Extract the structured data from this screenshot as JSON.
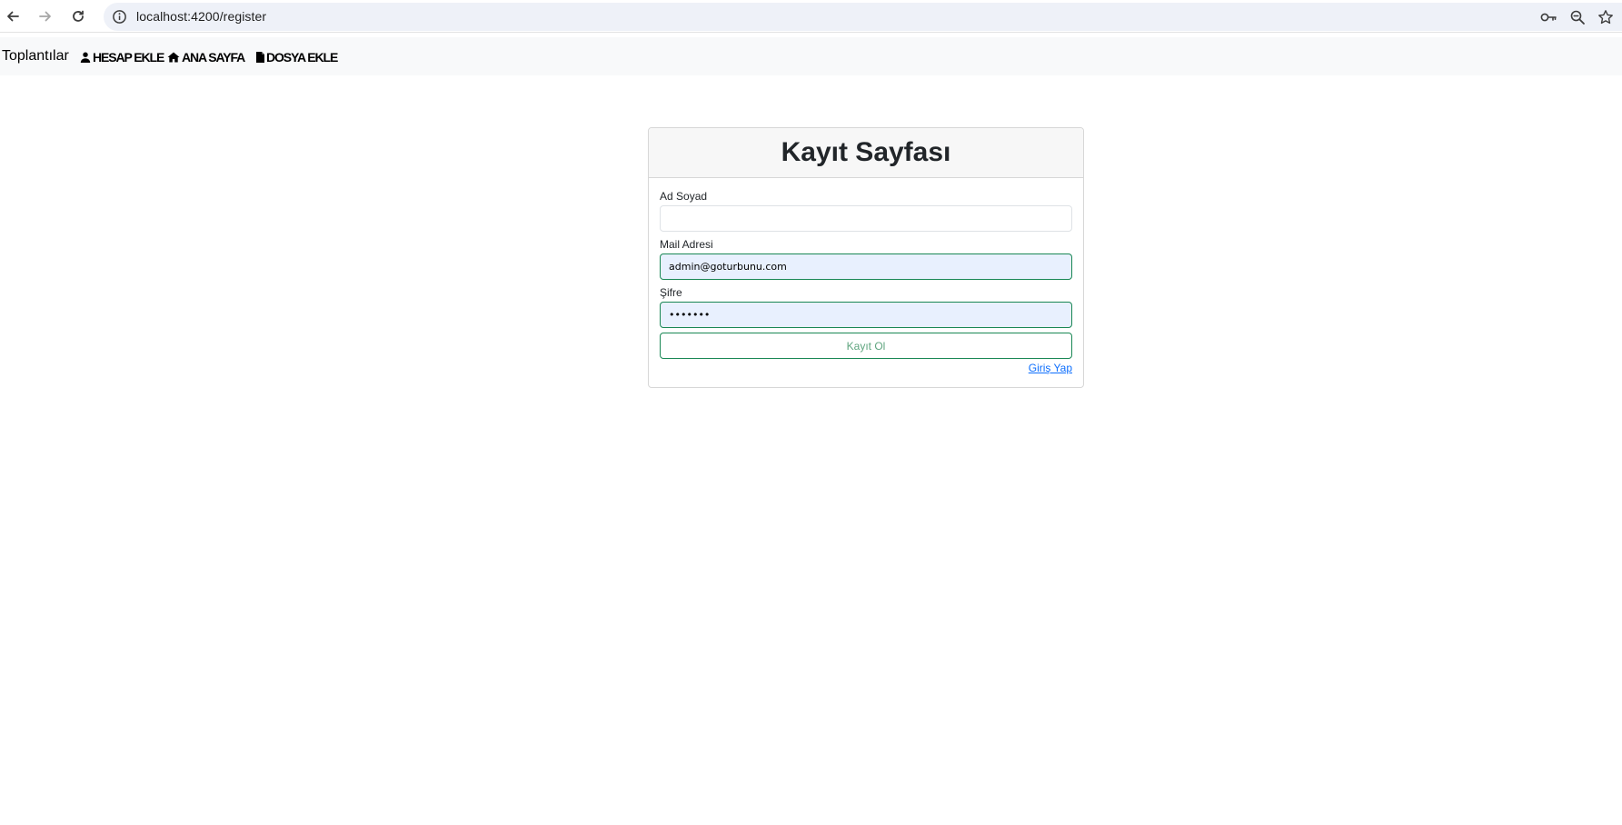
{
  "browser": {
    "url": "localhost:4200/register",
    "icons": {
      "back": "arrow-left-icon",
      "forward": "arrow-right-icon",
      "reload": "reload-icon",
      "site_info": "info-icon",
      "password": "key-icon",
      "zoom": "zoom-icon",
      "bookmark": "star-icon"
    }
  },
  "navbar": {
    "brand": "Toplantılar",
    "links": [
      {
        "label": "HESAP EKLE",
        "icon": "user-icon"
      },
      {
        "label": "ANA SAYFA",
        "icon": "home-icon"
      },
      {
        "label": "DOSYA EKLE",
        "icon": "file-icon"
      }
    ]
  },
  "register_card": {
    "title": "Kayıt Sayfası",
    "name_label": "Ad Soyad",
    "name_value": "",
    "email_label": "Mail Adresi",
    "email_value": "admin@goturbunu.com",
    "password_label": "Şifre",
    "password_value": "•••••••",
    "submit_label": "Kayıt Ol",
    "login_link": "Giriş Yap"
  },
  "colors": {
    "accent_green": "#198754",
    "autofill_bg": "#e8f0fe",
    "link_blue": "#0d6efd"
  }
}
